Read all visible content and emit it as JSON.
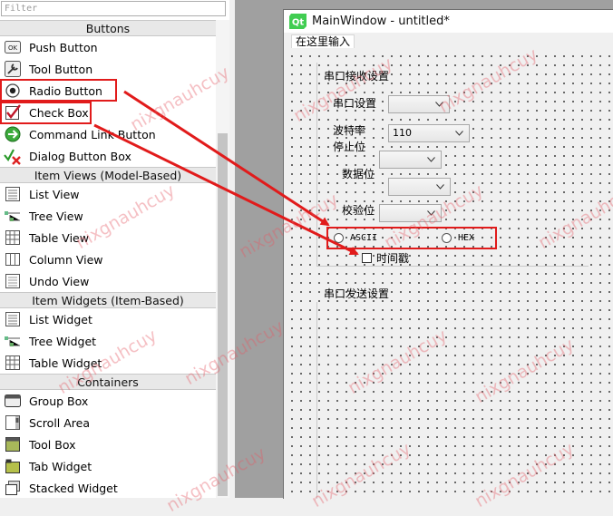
{
  "widget_box": {
    "filter_placeholder": "Filter",
    "categories": [
      {
        "title": "Buttons",
        "items": [
          {
            "label": "Push Button",
            "icon": "push-button-icon"
          },
          {
            "label": "Tool Button",
            "icon": "tool-button-icon"
          },
          {
            "label": "Radio Button",
            "icon": "radio-button-icon"
          },
          {
            "label": "Check Box",
            "icon": "check-box-icon"
          },
          {
            "label": "Command Link Button",
            "icon": "command-link-icon"
          },
          {
            "label": "Dialog Button Box",
            "icon": "dialog-button-box-icon"
          }
        ]
      },
      {
        "title": "Item Views (Model-Based)",
        "items": [
          {
            "label": "List View",
            "icon": "list-view-icon"
          },
          {
            "label": "Tree View",
            "icon": "tree-view-icon"
          },
          {
            "label": "Table View",
            "icon": "table-view-icon"
          },
          {
            "label": "Column View",
            "icon": "column-view-icon"
          },
          {
            "label": "Undo View",
            "icon": "undo-view-icon"
          }
        ]
      },
      {
        "title": "Item Widgets (Item-Based)",
        "items": [
          {
            "label": "List Widget",
            "icon": "list-widget-icon"
          },
          {
            "label": "Tree Widget",
            "icon": "tree-widget-icon"
          },
          {
            "label": "Table Widget",
            "icon": "table-widget-icon"
          }
        ]
      },
      {
        "title": "Containers",
        "items": [
          {
            "label": "Group Box",
            "icon": "group-box-icon"
          },
          {
            "label": "Scroll Area",
            "icon": "scroll-area-icon"
          },
          {
            "label": "Tool Box",
            "icon": "tool-box-icon"
          },
          {
            "label": "Tab Widget",
            "icon": "tab-widget-icon"
          },
          {
            "label": "Stacked Widget",
            "icon": "stacked-widget-icon"
          }
        ]
      }
    ]
  },
  "form": {
    "window_title": "MainWindow - untitled*",
    "menubar_placeholder": "在这里输入",
    "receive_group": {
      "title": "串口接收设置",
      "port_label": "串口设置",
      "baud_label": "波特率",
      "baud_value": "110",
      "stop_label": "停止位",
      "data_label": "数据位",
      "parity_label": "校验位",
      "radio_ascii": "ASCII",
      "radio_hex": "HEX",
      "timestamp_label": "时间戳"
    },
    "send_group": {
      "title": "串口发送设置"
    }
  },
  "watermark_text": "nixgnauhcuy",
  "colors": {
    "annotation_red": "#e11b1b",
    "watermark": "#e65a64",
    "canvas_bg": "#f0f0f0",
    "qt_green": "#41cd52"
  }
}
